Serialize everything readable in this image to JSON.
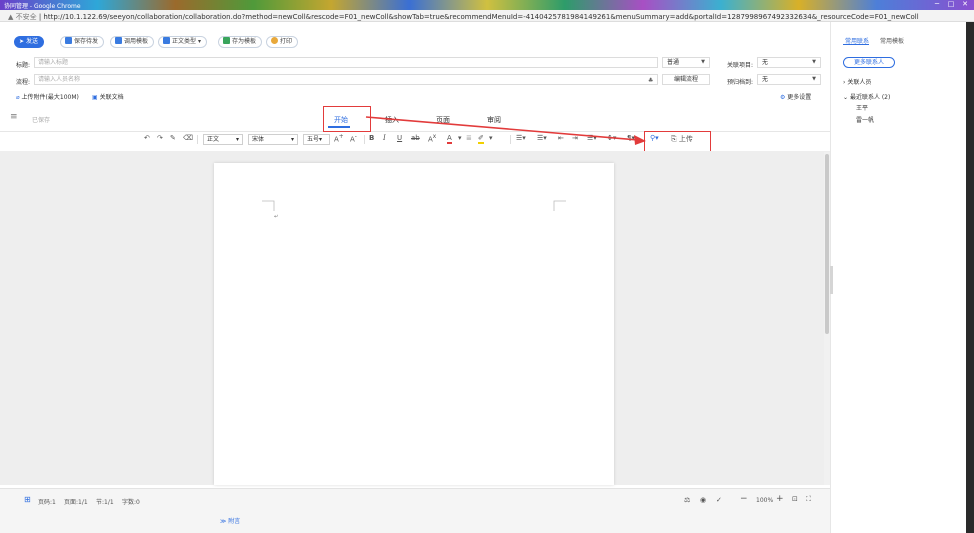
{
  "window": {
    "title": "协同管理 - Google Chrome",
    "min": "─",
    "max": "□",
    "close": "✕"
  },
  "address": {
    "security": "▲ 不安全",
    "url": "http://10.1.122.69/seeyon/collaboration/collaboration.do?method=newColl&rescode=F01_newColl&showTab=true&recommendMenuId=-4140425781984149261&menuSummary=add&portalId=1287998967492332634&_resourceCode=F01_newColl"
  },
  "toolbar": {
    "send": "发送",
    "save_draft": "保存待发",
    "call_template": "调用模板",
    "body_type": "正文类型",
    "save_template": "存为模板",
    "print": "打印"
  },
  "form": {
    "title_label": "标题:",
    "title_placeholder": "请输入标题",
    "priority_value": "普通",
    "related_project_label": "关联项目:",
    "related_project_value": "无",
    "flow_label": "流程:",
    "flow_placeholder": "请输入人员名称",
    "edit_flow": "编辑流程",
    "archive_label": "预归档到:",
    "archive_value": "无",
    "upload_attachment": "上传附件(最大100M)",
    "link_doc": "关联文档",
    "more_settings": "更多设置"
  },
  "editor": {
    "saved_status": "已保存",
    "tabs": [
      "开始",
      "插入",
      "页面",
      "审阅"
    ],
    "style_dropdown": "正文",
    "font_dropdown": "宋体",
    "size_dropdown": "五号",
    "upload_tool": "上传"
  },
  "status": {
    "page": "页码:1",
    "pages": "页面:1/1",
    "section": "节:1/1",
    "wordcount": "字数:0",
    "zoom": "100%",
    "attachment": "附言"
  },
  "right_panel": {
    "tab_contacts": "常用联系",
    "tab_templates": "常用模板",
    "more_contacts": "更多联系人",
    "related_people": "关联人员",
    "recent_contacts": "最近联系人 (2)",
    "contacts": [
      "王平",
      "雷一帆"
    ]
  }
}
